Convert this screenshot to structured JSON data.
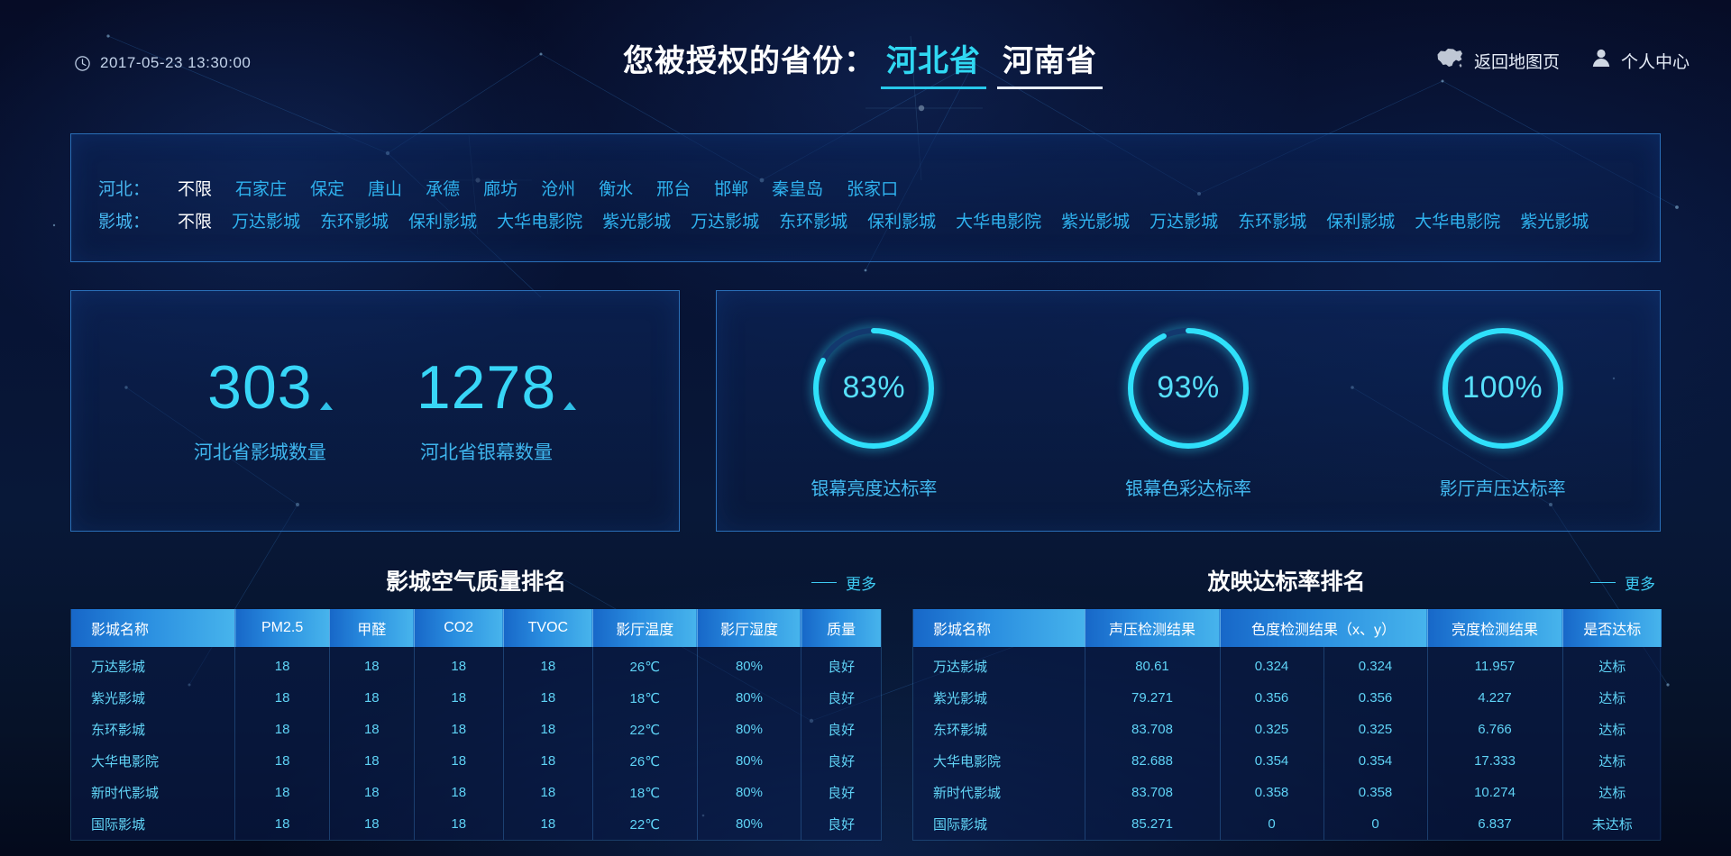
{
  "header": {
    "clock_icon": "clock-icon",
    "datetime": "2017-05-23  13:30:00",
    "title_prefix": "您被授权的省份：",
    "provinces": [
      {
        "label": "河北省",
        "active": true
      },
      {
        "label": "河南省",
        "active": false
      }
    ],
    "map_icon": "china-map-icon",
    "map_link": "返回地图页",
    "user_icon": "user-icon",
    "user_link": "个人中心"
  },
  "filters": {
    "city": {
      "label": "河北：",
      "selected": "不限",
      "items": [
        "不限",
        "石家庄",
        "保定",
        "唐山",
        "承德",
        "廊坊",
        "沧州",
        "衡水",
        "邢台",
        "邯郸",
        "秦皇岛",
        "张家口"
      ]
    },
    "cinema": {
      "label": "影城：",
      "selected": "不限",
      "items": [
        "不限",
        "万达影城",
        "东环影城",
        "保利影城",
        "大华电影院",
        "紫光影城",
        "万达影城",
        "东环影城",
        "保利影城",
        "大华电影院",
        "紫光影城",
        "万达影城",
        "东环影城",
        "保利影城",
        "大华电影院",
        "紫光影城"
      ]
    }
  },
  "stats": {
    "counts": [
      {
        "value": "303",
        "label": "河北省影城数量",
        "trend": "up"
      },
      {
        "value": "1278",
        "label": "河北省银幕数量",
        "trend": "up"
      }
    ],
    "gauges": [
      {
        "value": "83%",
        "percent": 83,
        "label": "银幕亮度达标率"
      },
      {
        "value": "93%",
        "percent": 93,
        "label": "银幕色彩达标率"
      },
      {
        "value": "100%",
        "percent": 100,
        "label": "影厅声压达标率"
      }
    ]
  },
  "air_table": {
    "title": "影城空气质量排名",
    "more": "更多",
    "columns": [
      "影城名称",
      "PM2.5",
      "甲醛",
      "CO2",
      "TVOC",
      "影厅温度",
      "影厅湿度",
      "质量"
    ],
    "rows": [
      [
        "万达影城",
        "18",
        "18",
        "18",
        "18",
        "26℃",
        "80%",
        "良好"
      ],
      [
        "紫光影城",
        "18",
        "18",
        "18",
        "18",
        "18℃",
        "80%",
        "良好"
      ],
      [
        "东环影城",
        "18",
        "18",
        "18",
        "18",
        "22℃",
        "80%",
        "良好"
      ],
      [
        "大华电影院",
        "18",
        "18",
        "18",
        "18",
        "26℃",
        "80%",
        "良好"
      ],
      [
        "新时代影城",
        "18",
        "18",
        "18",
        "18",
        "18℃",
        "80%",
        "良好"
      ],
      [
        "国际影城",
        "18",
        "18",
        "18",
        "18",
        "22℃",
        "80%",
        "良好"
      ]
    ]
  },
  "rate_table": {
    "title": "放映达标率排名",
    "more": "更多",
    "columns": [
      "影城名称",
      "声压检测结果",
      "色度检测结果（x、y）",
      "亮度检测结果",
      "是否达标"
    ],
    "rows": [
      [
        "万达影城",
        "80.61",
        "0.324",
        "0.324",
        "11.957",
        "达标"
      ],
      [
        "紫光影城",
        "79.271",
        "0.356",
        "0.356",
        "4.227",
        "达标"
      ],
      [
        "东环影城",
        "83.708",
        "0.325",
        "0.325",
        "6.766",
        "达标"
      ],
      [
        "大华电影院",
        "82.688",
        "0.354",
        "0.354",
        "17.333",
        "达标"
      ],
      [
        "新时代影城",
        "83.708",
        "0.358",
        "0.358",
        "10.274",
        "达标"
      ],
      [
        "国际影城",
        "85.271",
        "0",
        "0",
        "6.837",
        "未达标"
      ]
    ]
  },
  "colors": {
    "accent": "#30d8f2",
    "panel_border": "#2a6fb8",
    "header_gradient_start": "#1767c8",
    "header_gradient_end": "#47b4ec",
    "text_cyan": "#5fd3f6"
  }
}
